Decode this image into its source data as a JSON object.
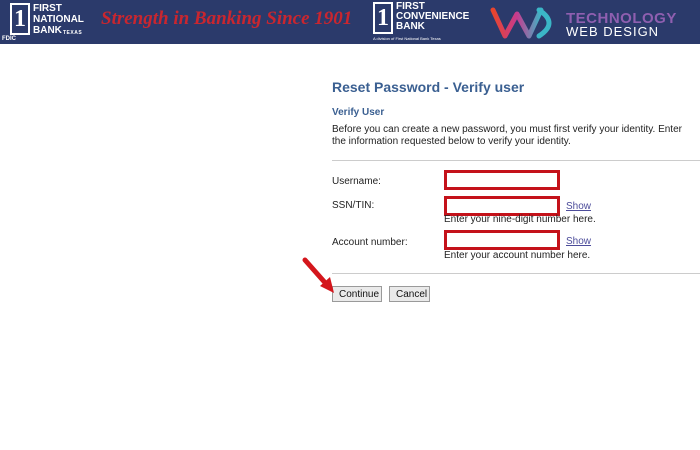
{
  "banner": {
    "fnb_logo": {
      "numeral": "1",
      "line1": "FIRST",
      "line2": "NATIONAL",
      "line3": "BANK",
      "state": "TEXAS",
      "fdic": "FDIC"
    },
    "slogan": "Strength in Banking Since 1901",
    "fcb_logo": {
      "numeral": "1",
      "line1": "FIRST",
      "line2": "CONVENIENCE",
      "line3": "BANK",
      "subline": "A division of First National Bank Texas"
    },
    "twd_logo": {
      "line1": "TECHNOLOGY",
      "line2": "WEB DESIGN"
    }
  },
  "form": {
    "page_title": "Reset Password - Verify user",
    "section_title": "Verify User",
    "intro": "Before you can create a new password, you must first verify your identity. Enter the information requested below to verify your identity.",
    "fields": {
      "username": {
        "label": "Username:",
        "value": ""
      },
      "ssn": {
        "label": "SSN/TIN:",
        "value": "",
        "show": "Show",
        "hint": "Enter your nine-digit number here."
      },
      "account": {
        "label": "Account number:",
        "value": "",
        "show": "Show",
        "hint": "Enter your account number here."
      }
    },
    "buttons": {
      "continue": "Continue",
      "cancel": "Cancel"
    }
  },
  "colors": {
    "banner": "#2b3a6b",
    "title": "#3a5f91",
    "highlight": "#c4121a",
    "slogan": "#c9262f"
  },
  "icons": [
    "red-arrow-pointer-icon",
    "twd-logo-mark-icon"
  ]
}
